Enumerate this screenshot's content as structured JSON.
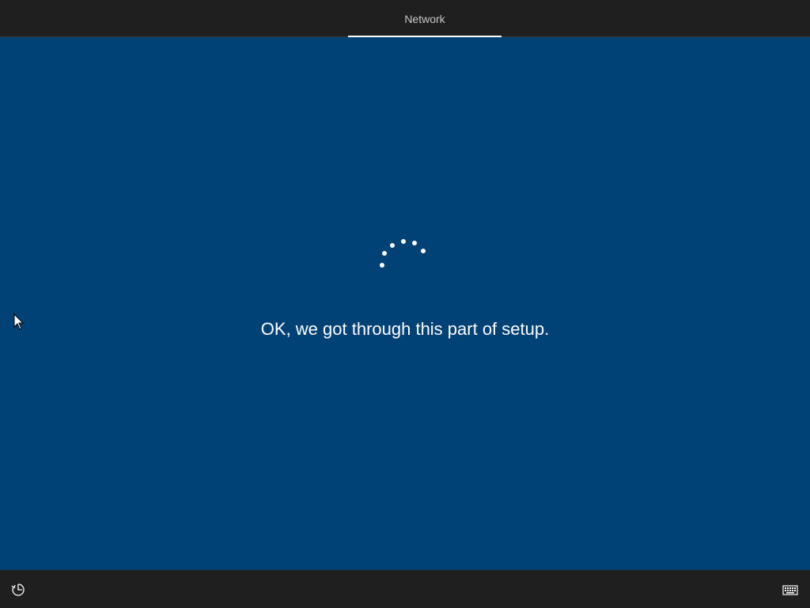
{
  "header": {
    "tabs": [
      {
        "label": "Network",
        "active": true
      }
    ]
  },
  "main": {
    "message": "OK, we got through this part of setup.",
    "progress_indicator": "loading-spinner"
  },
  "footer": {
    "left_icon": "ease-of-access-icon",
    "right_icon": "keyboard-icon"
  },
  "colors": {
    "background": "#004275",
    "bars": "#1f1f1f",
    "text": "#ffffff",
    "tab_text": "#c8c8c8"
  }
}
